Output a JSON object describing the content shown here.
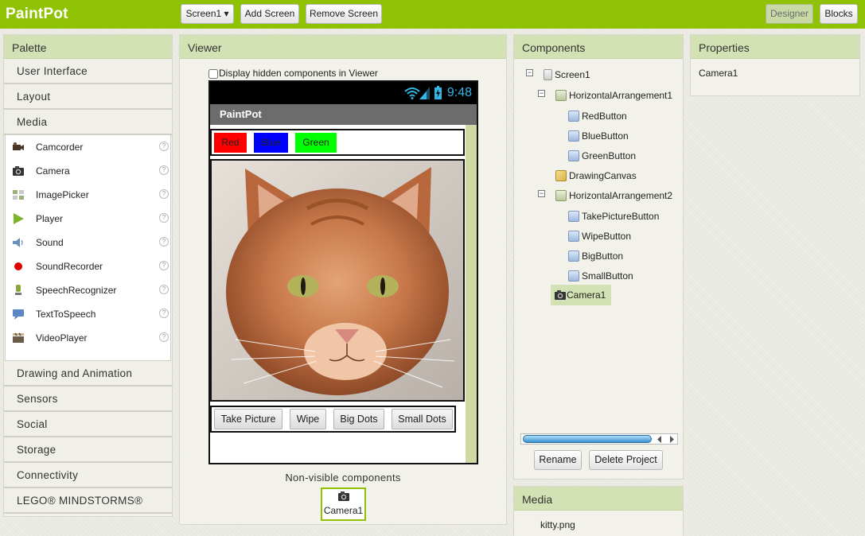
{
  "app": {
    "title": "PaintPot",
    "screen_selector": "Screen1 ▾",
    "add_screen": "Add Screen",
    "remove_screen": "Remove Screen",
    "designer": "Designer",
    "blocks": "Blocks"
  },
  "palette": {
    "title": "Palette",
    "categories_before": [
      "User Interface",
      "Layout",
      "Media"
    ],
    "media_items": [
      {
        "label": "Camcorder",
        "icon": "camcorder-icon"
      },
      {
        "label": "Camera",
        "icon": "camera-icon"
      },
      {
        "label": "ImagePicker",
        "icon": "imagepicker-icon"
      },
      {
        "label": "Player",
        "icon": "player-icon"
      },
      {
        "label": "Sound",
        "icon": "sound-icon"
      },
      {
        "label": "SoundRecorder",
        "icon": "soundrecorder-icon"
      },
      {
        "label": "SpeechRecognizer",
        "icon": "speechrecognizer-icon"
      },
      {
        "label": "TextToSpeech",
        "icon": "texttospeech-icon"
      },
      {
        "label": "VideoPlayer",
        "icon": "videoplayer-icon"
      }
    ],
    "help_glyph": "?",
    "categories_after": [
      "Drawing and Animation",
      "Sensors",
      "Social",
      "Storage",
      "Connectivity",
      "LEGO® MINDSTORMS®"
    ]
  },
  "viewer": {
    "title": "Viewer",
    "hidden_checkbox_label": "Display hidden components in Viewer",
    "hidden_checked": false,
    "phone": {
      "time": "9:48",
      "app_title": "PaintPot",
      "color_buttons": [
        {
          "label": "Red",
          "color": "#ff0000"
        },
        {
          "label": "Blue",
          "color": "#0000ff"
        },
        {
          "label": "Green",
          "color": "#00ff00"
        }
      ],
      "action_buttons": [
        "Take Picture",
        "Wipe",
        "Big Dots",
        "Small Dots"
      ]
    },
    "nonvisible_label": "Non-visible components",
    "nonvisible_items": [
      "Camera1"
    ]
  },
  "components": {
    "title": "Components",
    "tree": {
      "screen": "Screen1",
      "ha1": "HorizontalArrangement1",
      "red": "RedButton",
      "blue": "BlueButton",
      "green": "GreenButton",
      "canvas": "DrawingCanvas",
      "ha2": "HorizontalArrangement2",
      "take": "TakePictureButton",
      "wipe": "WipeButton",
      "big": "BigButton",
      "small": "SmallButton",
      "camera": "Camera1"
    },
    "collapse_glyph": "−",
    "rename": "Rename",
    "delete": "Delete Project"
  },
  "media": {
    "title": "Media",
    "files": [
      "kitty.png"
    ]
  },
  "properties": {
    "title": "Properties",
    "selected": "Camera1"
  },
  "colors": {
    "brand": "#8fc202",
    "panel_header": "#d3e2b4",
    "selection": "#d3e2b4"
  }
}
